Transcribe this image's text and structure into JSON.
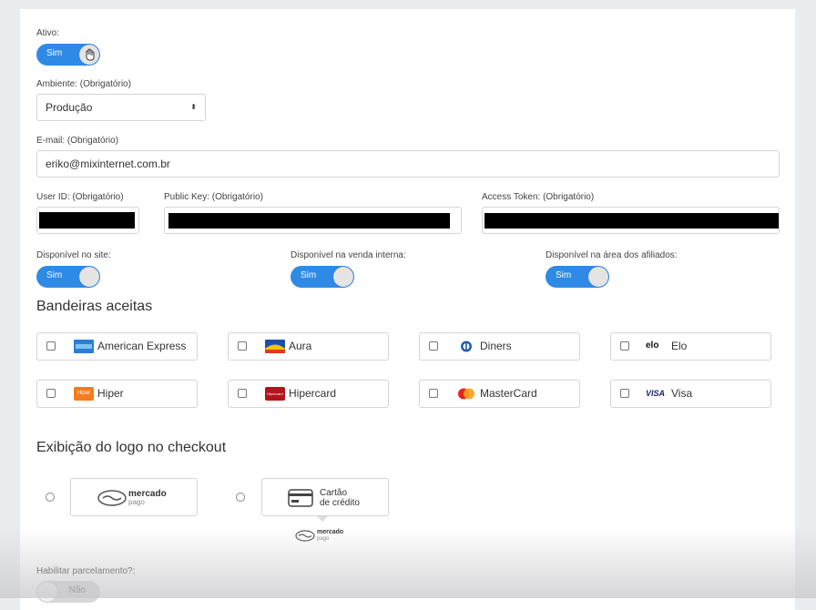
{
  "ativo": {
    "label": "Ativo:",
    "value": "Sim"
  },
  "ambiente": {
    "label": "Ambiente: (Obrigatório)",
    "value": "Produção"
  },
  "email": {
    "label": "E-mail: (Obrigatório)",
    "value": "eriko@mixinternet.com.br"
  },
  "user_id": {
    "label": "User ID: (Obrigatório)"
  },
  "public_key": {
    "label": "Public Key: (Obrigatório)"
  },
  "access_token": {
    "label": "Access Token: (Obrigatório)"
  },
  "disponivel": [
    {
      "label": "Disponível no site:",
      "value": "Sim"
    },
    {
      "label": "Disponível na venda interna:",
      "value": "Sim"
    },
    {
      "label": "Disponível na área dos afiliados:",
      "value": "Sim"
    }
  ],
  "bandeiras": {
    "title": "Bandeiras aceitas",
    "items": [
      {
        "label": "American Express",
        "icon": "amex-icon"
      },
      {
        "label": "Aura",
        "icon": "aura-icon"
      },
      {
        "label": "Diners",
        "icon": "diners-icon"
      },
      {
        "label": "Elo",
        "icon": "elo-icon",
        "logo_text": "elo"
      },
      {
        "label": "Hiper",
        "icon": "hiper-icon",
        "logo_text": "Hiper"
      },
      {
        "label": "Hipercard",
        "icon": "hipercard-icon",
        "logo_text": "Hipercard"
      },
      {
        "label": "MasterCard",
        "icon": "mastercard-icon"
      },
      {
        "label": "Visa",
        "icon": "visa-icon",
        "logo_text": "VISA"
      }
    ]
  },
  "exibicao": {
    "title": "Exibição do logo no checkout",
    "option1": {
      "logo_line1": "mercado",
      "logo_line2": "pago"
    },
    "option2": {
      "line1": "Cartão",
      "line2": "de crédito",
      "sub_line1": "mercado",
      "sub_line2": "pago"
    }
  },
  "parcelamento": {
    "label": "Habilitar parcelamento?:",
    "value": "Não"
  }
}
